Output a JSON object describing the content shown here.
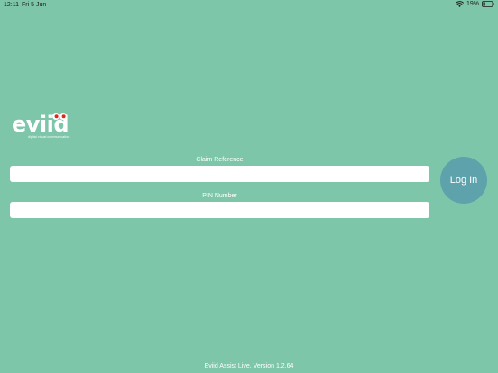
{
  "status_bar": {
    "time": "12:11",
    "date": "Fri 5 Jun",
    "battery": "19%",
    "icons": [
      "wifi-icon",
      "battery-icon"
    ]
  },
  "logo": {
    "text": "eviid",
    "tagline": "digital visual communication",
    "eye_color": "#e2261c"
  },
  "form": {
    "claim_label": "Claim Reference",
    "claim_value": "",
    "pin_label": "PIN Number",
    "pin_value": ""
  },
  "login_button": {
    "label": "Log In",
    "color": "#5ea2ac"
  },
  "footer": {
    "version": "Eviid Assist Live, Version 1.2.64"
  },
  "colors": {
    "background": "#7ec6aa"
  }
}
